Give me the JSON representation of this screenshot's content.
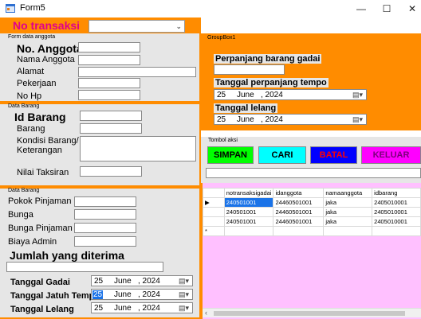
{
  "window": {
    "title": "Form5",
    "minimize": "—",
    "maximize": "☐",
    "close": "✕"
  },
  "top": {
    "no_transaksi_label": "No transaksi",
    "no_transaksi_value": ""
  },
  "anggota": {
    "group_title": "Form data anggota",
    "no_anggota_label": "No. Anggota",
    "nama_label": "Nama Anggota",
    "alamat_label": "Alamat",
    "pekerjaan_label": "Pekerjaan",
    "nohp_label": "No Hp"
  },
  "barang": {
    "group_title": "Data Barang",
    "id_label": "Id Barang",
    "barang_label": "Barang",
    "kondisi_label_1": "Kondisi Barang/",
    "kondisi_label_2": "Keterangan",
    "nilai_label": "Nilai Taksiran"
  },
  "pinjaman": {
    "group_title": "Data Barang",
    "pokok_label": "Pokok Pinjaman",
    "bunga_label": "Bunga",
    "bunga_pinjaman_label": "Bunga Pinjaman",
    "biaya_admin_label": "Biaya Admin",
    "jumlah_label": "Jumlah yang diterima",
    "tgl_gadai_label": "Tanggal Gadai",
    "tgl_jatuh_label": "Tanggal Jatuh Tempo",
    "tgl_lelang_label": "Tanggal Lelang",
    "tgl_gadai": {
      "day": "25",
      "month": "June",
      "year": ", 2024"
    },
    "tgl_jatuh": {
      "day": "25",
      "month": "June",
      "year": ", 2024"
    },
    "tgl_lelang": {
      "day": "25",
      "month": "June",
      "year": ", 2024"
    }
  },
  "groupbox1": {
    "title": "GroupBox1",
    "perpanjang_label": "Perpanjang barang gadai",
    "tgl_perpanjang_label": "Tanggal perpanjang tempo",
    "tgl_perpanjang": {
      "day": "25",
      "month": "June",
      "year": ", 2024"
    },
    "tgl_lelang_label": "Tanggal lelang",
    "tgl_lelang": {
      "day": "25",
      "month": "June",
      "year": ", 2024"
    }
  },
  "aksi": {
    "title": "Tombol aksi",
    "simpan": "SIMPAN",
    "cari": "CARI",
    "batal": "BATAL",
    "keluar": "KELUAR"
  },
  "grid": {
    "columns": [
      "notransaksigadai",
      "idanggota",
      "namaanggota",
      "idbarang"
    ],
    "rows": [
      [
        "240501001",
        "24460501001",
        "jaka",
        "2405010001"
      ],
      [
        "240501001",
        "24460501001",
        "jaka",
        "2405010001"
      ],
      [
        "240501001",
        "24460501001",
        "jaka",
        "2405010001"
      ]
    ],
    "new_row_marker": "*",
    "current_row_marker": "▶"
  },
  "colors": {
    "accent": "#ff8c00",
    "title_pink": "#e0008c",
    "simpan": "#00ff00",
    "cari": "#00ffff",
    "batal": "#0000ff",
    "keluar": "#ff00ff",
    "grid_bg": "#ffc0ff"
  }
}
